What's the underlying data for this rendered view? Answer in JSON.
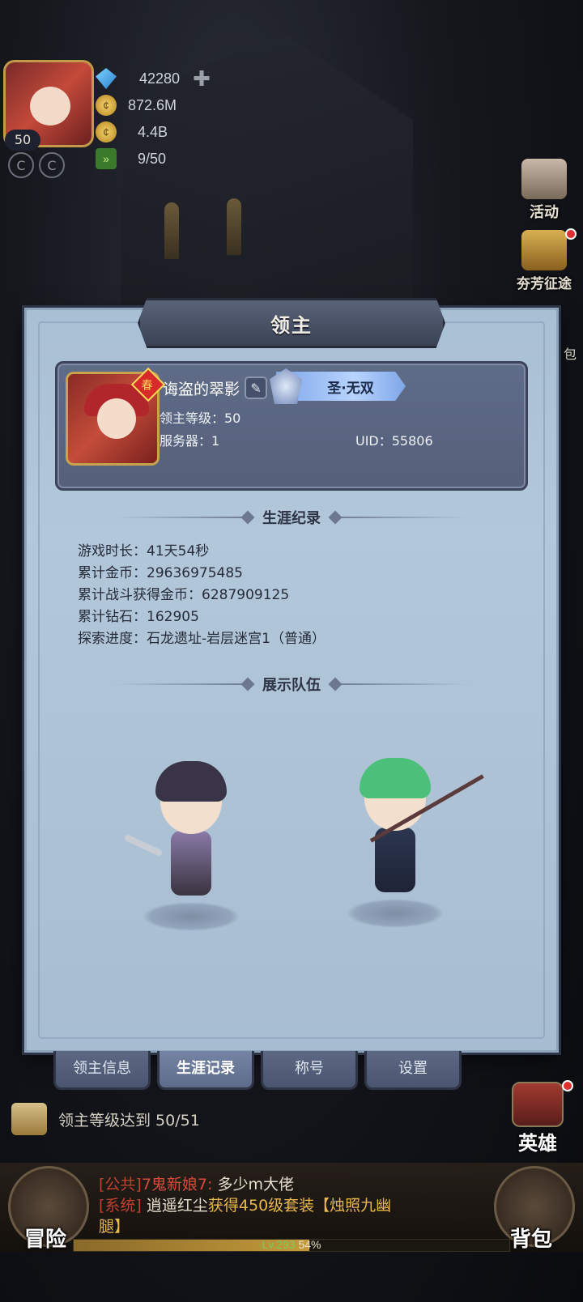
{
  "hud": {
    "player_level": "50",
    "diamonds": "42280",
    "gold": "872.6M",
    "gold2": "4.4B",
    "energy": "9/50",
    "plus_icon": "plus-icon"
  },
  "side_menu": {
    "activity": "活动",
    "contest": "夯芳征途",
    "bag_partial": "包",
    "hero": "英雄"
  },
  "dialog": {
    "title": "领主",
    "profile": {
      "name": "诲盗的翠影",
      "title_badge": "圣·无双",
      "level": "领主等级：50",
      "server": "服务器：1",
      "uid": "UID：55806",
      "avatar_tag": "春"
    },
    "career": {
      "heading": "生涯纪录",
      "play_time": "游戏时长：41天54秒",
      "total_gold": "累计金币：29636975485",
      "battle_gold": "累计战斗获得金币：6287909125",
      "total_diamonds": "累计钻石：162905",
      "progress": "探索进度：石龙遗址-岩层迷宫1（普通）"
    },
    "team": {
      "heading": "展示队伍"
    },
    "tabs": [
      {
        "label": "领主信息",
        "active": false
      },
      {
        "label": "生涯记录",
        "active": true
      },
      {
        "label": "称号",
        "active": false
      },
      {
        "label": "设置",
        "active": false
      }
    ]
  },
  "quest": {
    "text": "领主等级达到 50/51"
  },
  "chat": {
    "line1_channel": "[公共]",
    "line1_name": "7鬼新娘7:",
    "line1_text": "多少m大佬",
    "line2_channel": "[系统]",
    "line2_name": "逍遥红尘",
    "line2_text_a": "获得450级套装",
    "line2_text_b": "【烛照九幽",
    "line3_text": "腿】"
  },
  "bottom": {
    "adventure": "冒险",
    "backpack": "背包",
    "xp_level": "Lv.293",
    "xp_percent": "54%",
    "xp_fraction": 0.54
  }
}
